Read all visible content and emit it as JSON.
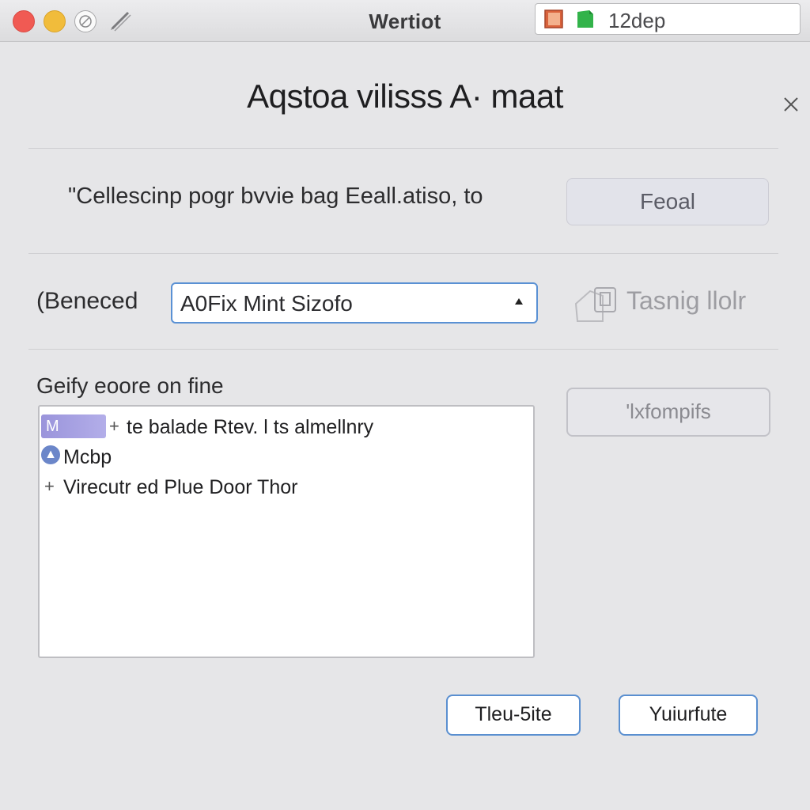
{
  "window": {
    "title": "Wertiot",
    "search_value": "12dep"
  },
  "dialog": {
    "title": "Aqstoa vilisss A· maat",
    "description": "\"Cellescinp pogr bvvie bag Eeall.atiso, to",
    "primary_button": "Feoal",
    "field": {
      "label": "(Beneced",
      "selected_value": "A0Fix Mint Sizofo"
    },
    "ghost_action": "Tasnig llolr",
    "list_label": "Geify eoore on fine",
    "list_items": [
      {
        "badge": "M",
        "label": "te balade Rtev. l ts almellnry"
      },
      {
        "label": "Mcbp"
      },
      {
        "label": "Virecutr ed Plue Door Thor"
      }
    ],
    "side_button": "'lxfompifs",
    "footer": {
      "left_button": "Tleu-5ite",
      "right_button": "Yuiurfute"
    }
  },
  "colors": {
    "accent": "#5a91d4",
    "badge": "#9a94db",
    "close_red": "#f05a53",
    "minimize_yellow": "#f1bc3b"
  },
  "icons": {
    "close": "close-icon",
    "pencil": "pencil-icon",
    "book": "book-icon",
    "document": "green-document-icon",
    "ghost": "folder-icon"
  }
}
